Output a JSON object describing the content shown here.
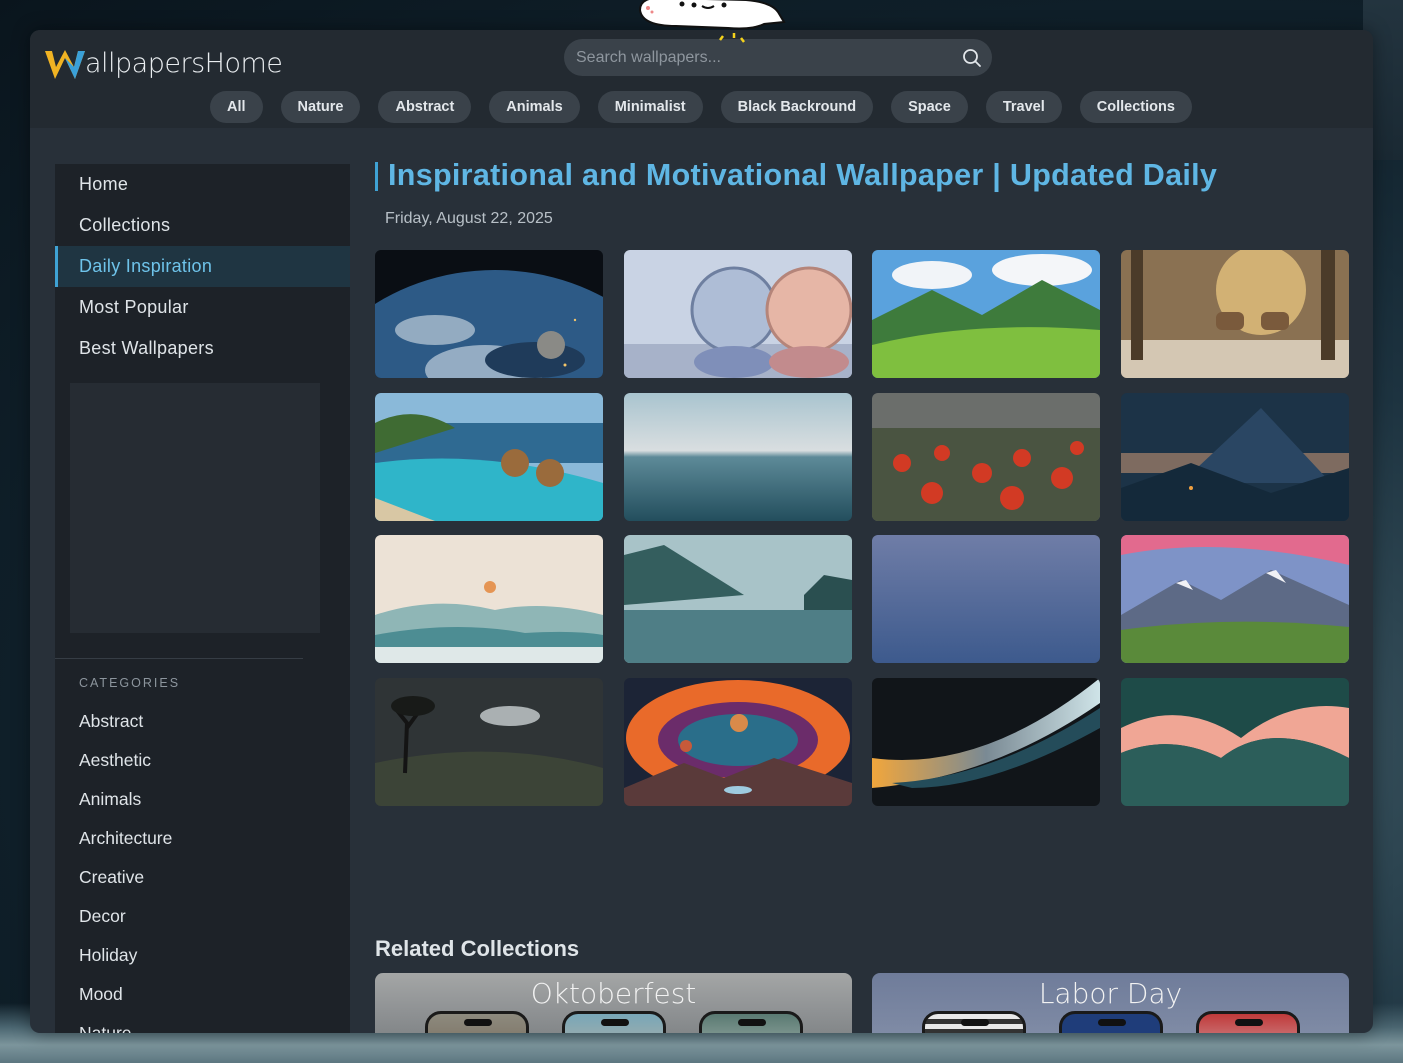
{
  "header": {
    "logo_initial": "W",
    "logo_text": "allpapersHome",
    "search_placeholder": "Search wallpapers...",
    "pills": [
      "All",
      "Nature",
      "Abstract",
      "Animals",
      "Minimalist",
      "Black Backround",
      "Space",
      "Travel",
      "Collections"
    ]
  },
  "sidebar": {
    "nav": [
      {
        "label": "Home",
        "active": false
      },
      {
        "label": "Collections",
        "active": false
      },
      {
        "label": "Daily Inspiration",
        "active": true
      },
      {
        "label": "Most Popular",
        "active": false
      },
      {
        "label": "Best Wallpapers",
        "active": false
      }
    ],
    "categories_title": "CATEGORIES",
    "categories": [
      "Abstract",
      "Aesthetic",
      "Animals",
      "Architecture",
      "Creative",
      "Decor",
      "Holiday",
      "Mood",
      "Nature"
    ]
  },
  "main": {
    "title": "Inspirational and Motivational Wallpaper | Updated Daily",
    "date": "Friday, August 22, 2025",
    "thumbnails": [
      "earth-from-space",
      "glass-spheres",
      "green-hills",
      "deer-in-forest",
      "resort-pool",
      "calm-sea",
      "poppy-field",
      "mountain-night",
      "misty-sunrise",
      "foggy-lake",
      "blue-gradient",
      "alpine-meadow",
      "dark-tree-landscape",
      "cosmic-planets",
      "abstract-wave-dark",
      "abstract-wave-teal"
    ],
    "related_title": "Related Collections",
    "collections": [
      "Oktoberfest",
      "Labor Day"
    ]
  },
  "colors": {
    "accent": "#5fb6e4",
    "panel": "#283039",
    "sidebar": "#1d2228"
  }
}
